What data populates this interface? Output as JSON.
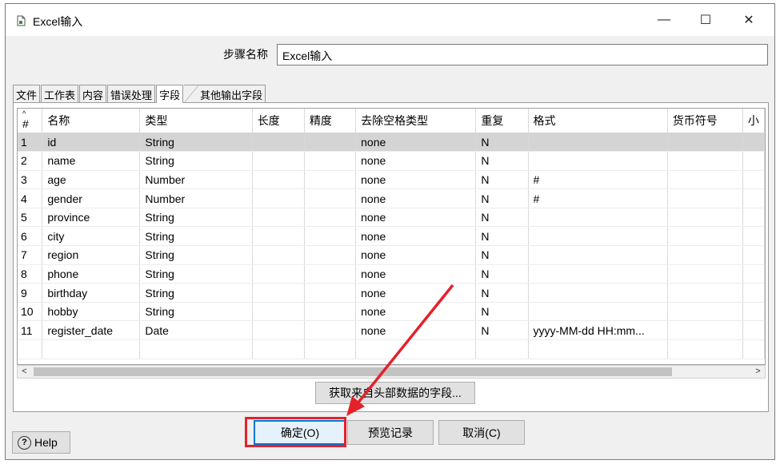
{
  "window": {
    "title": "Excel输入",
    "min_glyph": "—",
    "max_glyph": "☐",
    "close_glyph": "✕",
    "icon": "document-icon"
  },
  "step": {
    "label": "步骤名称",
    "value": "Excel输入"
  },
  "tabs": [
    {
      "label": "文件"
    },
    {
      "label": "工作表"
    },
    {
      "label": "内容"
    },
    {
      "label": "错误处理"
    },
    {
      "label": "字段",
      "active": true
    },
    {
      "label": "其他输出字段"
    }
  ],
  "grid": {
    "sort_glyph": "^",
    "columns": [
      "#",
      "名称",
      "类型",
      "长度",
      "精度",
      "去除空格类型",
      "重复",
      "格式",
      "货币符号",
      "小"
    ],
    "rows": [
      [
        "1",
        "id",
        "String",
        "",
        "",
        "none",
        "N",
        "",
        ""
      ],
      [
        "2",
        "name",
        "String",
        "",
        "",
        "none",
        "N",
        "",
        ""
      ],
      [
        "3",
        "age",
        "Number",
        "",
        "",
        "none",
        "N",
        "#",
        ""
      ],
      [
        "4",
        "gender",
        "Number",
        "",
        "",
        "none",
        "N",
        "#",
        ""
      ],
      [
        "5",
        "province",
        "String",
        "",
        "",
        "none",
        "N",
        "",
        ""
      ],
      [
        "6",
        "city",
        "String",
        "",
        "",
        "none",
        "N",
        "",
        ""
      ],
      [
        "7",
        "region",
        "String",
        "",
        "",
        "none",
        "N",
        "",
        ""
      ],
      [
        "8",
        "phone",
        "String",
        "",
        "",
        "none",
        "N",
        "",
        ""
      ],
      [
        "9",
        "birthday",
        "String",
        "",
        "",
        "none",
        "N",
        "",
        ""
      ],
      [
        "10",
        "hobby",
        "String",
        "",
        "",
        "none",
        "N",
        "",
        ""
      ],
      [
        "11",
        "register_date",
        "Date",
        "",
        "",
        "none",
        "N",
        "yyyy-MM-dd HH:mm...",
        ""
      ]
    ]
  },
  "scrollbar": {
    "left_glyph": "<",
    "right_glyph": ">"
  },
  "buttons": {
    "get_fields": "获取来自头部数据的字段...",
    "ok": "确定(O)",
    "preview": "预览记录",
    "cancel": "取消(C)",
    "help": "Help",
    "help_glyph": "?"
  },
  "annotation": {
    "color": "#e5212a"
  }
}
